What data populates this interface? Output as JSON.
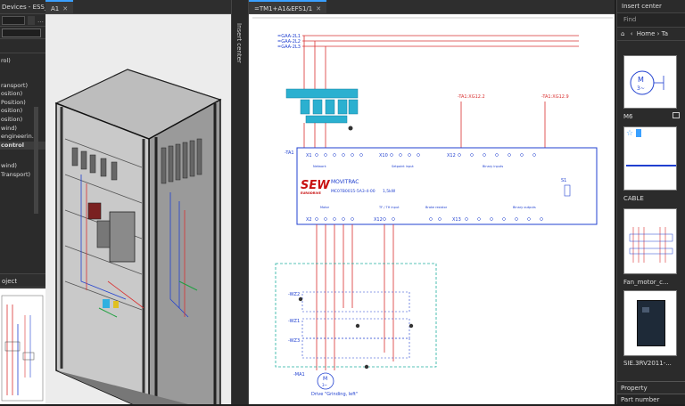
{
  "left_panel": {
    "tab_title": "Devices - ESS_...",
    "tree_items": [
      "rol)",
      "ransport)",
      "osition)",
      "Position)",
      "osition)",
      "osition)",
      "wind)",
      "engineerin...",
      "control",
      "wind)",
      "Transport)"
    ],
    "selected_item": "control",
    "bottom_tab": "oject"
  },
  "view3d": {
    "tab_label": "A1"
  },
  "insert_strip": {
    "label": "Insert center"
  },
  "schematic": {
    "tab_label": "=TM1+A1&EFS1/1",
    "feeds": [
      "=GAA-2L1",
      "=GAA-2L2",
      "=GAA-2L3"
    ],
    "device_tag": "-TA1",
    "power_rating": "1,5kW",
    "sew_logo": "SEW",
    "sew_sub": "EURODRIVE",
    "product": "MOVITRAC",
    "model": "MC07B0015-5A3-4-00",
    "connectors": [
      "X1",
      "X10",
      "X12",
      "X2",
      "X12",
      "X13"
    ],
    "section_labels": [
      "Network",
      "Setpoint input",
      "Binary inputs",
      "Motor",
      "TF / TH input",
      "Brake resistor",
      "Binary outputs"
    ],
    "term_refs": [
      "-TA1:XG12.2",
      "-TA1:XG12.9"
    ],
    "cables": [
      "-WZ2",
      "-WZ1",
      "-WZ3"
    ],
    "motor_tag": "-MA1",
    "motor_symbol": "M",
    "motor_phase": "3~",
    "drive_label": "Drive \"Grinding, left\"",
    "display_label": "S1"
  },
  "right_panel": {
    "title": "Insert center",
    "search_placeholder": "Find",
    "breadcrumb_home": "Home",
    "breadcrumb_next": "Ta",
    "items": [
      "M6",
      "CABLE",
      "Fan_motor_c...",
      "SIE.3RV2011-..."
    ],
    "property_title": "Property",
    "property_field": "Part number"
  },
  "colors": {
    "accent": "#3aa0ff",
    "wire_red": "#d93030",
    "wire_blue": "#2040d0",
    "sew_red": "#c81010",
    "cyan_device": "#2bb0d0"
  }
}
